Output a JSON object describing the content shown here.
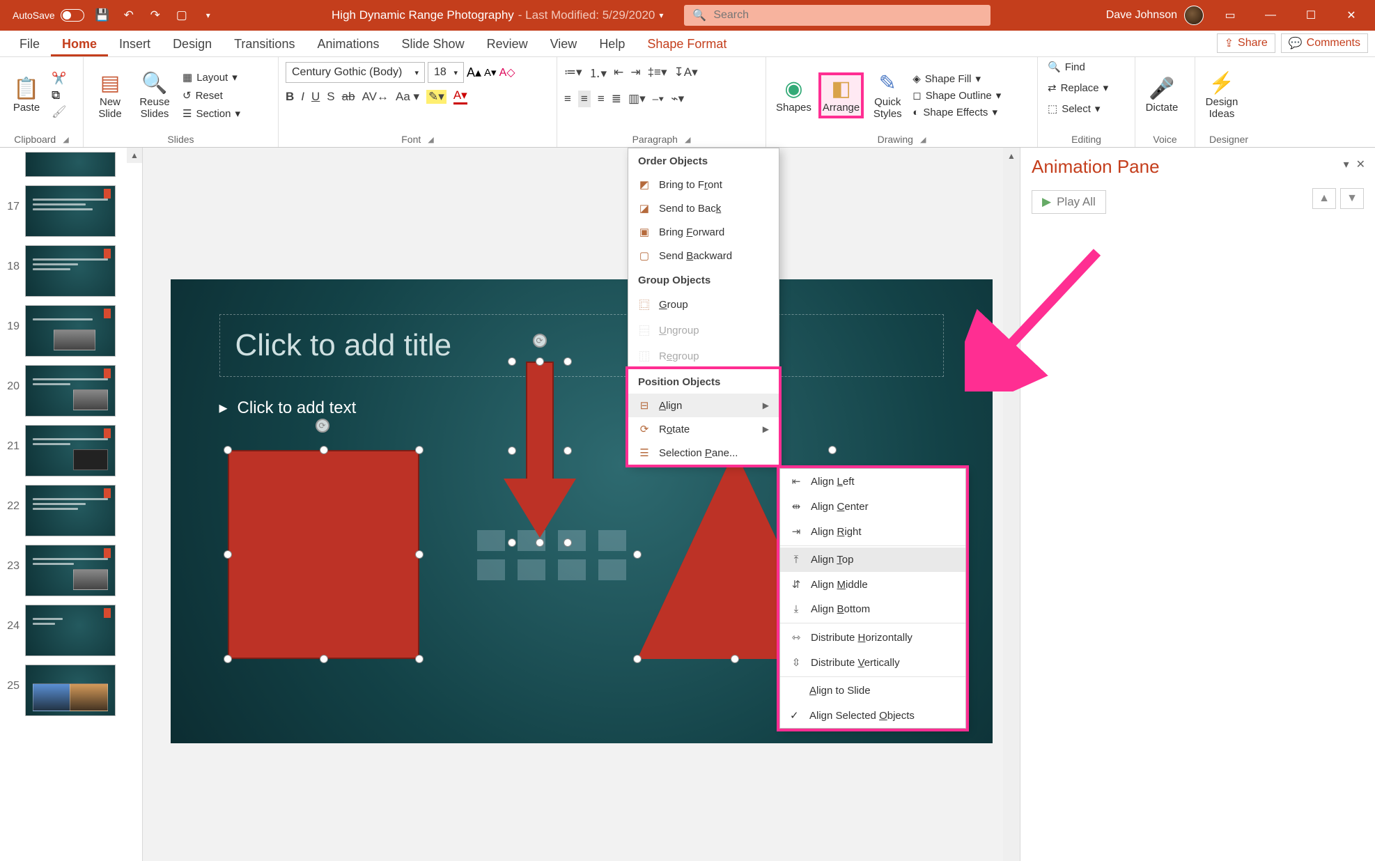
{
  "titlebar": {
    "autosave_label": "AutoSave",
    "doc_title": "High Dynamic Range Photography",
    "modified": "- Last Modified: 5/29/2020",
    "search_placeholder": "Search",
    "user_name": "Dave Johnson"
  },
  "tabs": {
    "file": "File",
    "home": "Home",
    "insert": "Insert",
    "design": "Design",
    "transitions": "Transitions",
    "animations": "Animations",
    "slideshow": "Slide Show",
    "review": "Review",
    "view": "View",
    "help": "Help",
    "shapeformat": "Shape Format",
    "share": "Share",
    "comments": "Comments"
  },
  "ribbon": {
    "clipboard": {
      "paste": "Paste",
      "label": "Clipboard"
    },
    "slides": {
      "newslide": "New\nSlide",
      "reuse": "Reuse\nSlides",
      "layout": "Layout",
      "reset": "Reset",
      "section": "Section",
      "label": "Slides"
    },
    "font": {
      "family": "Century Gothic (Body)",
      "size": "18",
      "label": "Font"
    },
    "paragraph": {
      "label": "Paragraph"
    },
    "drawing": {
      "shapes": "Shapes",
      "arrange": "Arrange",
      "quickstyles": "Quick\nStyles",
      "fill": "Shape Fill",
      "outline": "Shape Outline",
      "effects": "Shape Effects",
      "label": "Drawing"
    },
    "editing": {
      "find": "Find",
      "replace": "Replace",
      "select": "Select",
      "label": "Editing"
    },
    "voice": {
      "dictate": "Dictate",
      "label": "Voice"
    },
    "designer": {
      "ideas": "Design\nIdeas",
      "label": "Designer"
    }
  },
  "arrange_menu": {
    "order_header": "Order Objects",
    "bring_front": "Bring to Front",
    "send_back": "Send to Back",
    "bring_forward": "Bring Forward",
    "send_backward": "Send Backward",
    "group_header": "Group Objects",
    "group": "Group",
    "ungroup": "Ungroup",
    "regroup": "Regroup",
    "position_header": "Position Objects",
    "align": "Align",
    "rotate": "Rotate",
    "selection_pane": "Selection Pane..."
  },
  "align_menu": {
    "left": "Align Left",
    "center": "Align Center",
    "right": "Align Right",
    "top": "Align Top",
    "middle": "Align Middle",
    "bottom": "Align Bottom",
    "dist_h": "Distribute Horizontally",
    "dist_v": "Distribute Vertically",
    "to_slide": "Align to Slide",
    "selected": "Align Selected Objects"
  },
  "slide": {
    "title_placeholder": "Click to add title",
    "text_placeholder": "Click to add text"
  },
  "thumbs": {
    "n17": "17",
    "n18": "18",
    "n19": "19",
    "n20": "20",
    "n21": "21",
    "n22": "22",
    "n23": "23",
    "n24": "24",
    "n25": "25"
  },
  "anim_pane": {
    "title": "Animation Pane",
    "play_all": "Play All"
  }
}
